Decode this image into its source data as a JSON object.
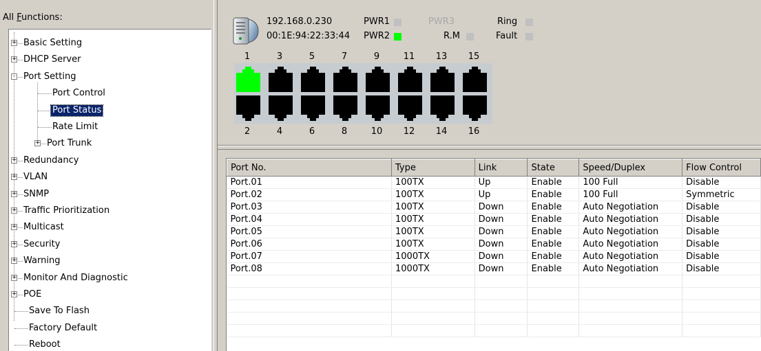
{
  "left_panel": {
    "title_prefix": "All ",
    "title_hotkey": "F",
    "title_rest": "unctions:"
  },
  "tree": [
    {
      "label": "Basic Setting",
      "expander": "+"
    },
    {
      "label": "DHCP Server",
      "expander": "+"
    },
    {
      "label": "Port Setting",
      "expander": "-"
    },
    {
      "label": "Port Control",
      "expander": ""
    },
    {
      "label": "Port Status",
      "expander": "",
      "selected": true
    },
    {
      "label": "Rate Limit",
      "expander": ""
    },
    {
      "label": "Port Trunk",
      "expander": "+"
    },
    {
      "label": "Redundancy",
      "expander": "+"
    },
    {
      "label": "VLAN",
      "expander": "+"
    },
    {
      "label": "SNMP",
      "expander": "+"
    },
    {
      "label": "Traffic Prioritization",
      "expander": "+"
    },
    {
      "label": "Multicast",
      "expander": "+"
    },
    {
      "label": "Security",
      "expander": "+"
    },
    {
      "label": "Warning",
      "expander": "+"
    },
    {
      "label": "Monitor And Diagnostic",
      "expander": "+"
    },
    {
      "label": "POE",
      "expander": "+"
    },
    {
      "label": "Save To Flash",
      "expander": ""
    },
    {
      "label": "Factory Default",
      "expander": ""
    },
    {
      "label": "Reboot",
      "expander": ""
    }
  ],
  "device": {
    "icon": "switch-device-icon",
    "ip": "192.168.0.230",
    "mac": "00:1E:94:22:33:44",
    "indicators": {
      "pwr1": {
        "label": "PWR1",
        "color": "#c0c0c0"
      },
      "pwr2": {
        "label": "PWR2",
        "color": "#00ff00"
      },
      "pwr3": {
        "label": "PWR3",
        "color": "#c0c0c0"
      },
      "rm": {
        "label": "R.M",
        "color": "#c0c0c0"
      },
      "ring": {
        "label": "Ring",
        "color": "#c0c0c0"
      },
      "fault": {
        "label": "Fault",
        "color": "#c0c0c0"
      }
    },
    "top_port_numbers": [
      "1",
      "3",
      "5",
      "7",
      "9",
      "11",
      "13",
      "15"
    ],
    "bottom_port_numbers": [
      "2",
      "4",
      "6",
      "8",
      "10",
      "12",
      "14",
      "16"
    ],
    "port_colors": {
      "active": "#00ff00",
      "inactive": "#000000"
    },
    "active_ports": [
      "1"
    ]
  },
  "table": {
    "columns": [
      "Port No.",
      "Type",
      "Link",
      "State",
      "Speed/Duplex",
      "Flow Control"
    ],
    "rows": [
      [
        "Port.01",
        "100TX",
        "Up",
        "Enable",
        "100 Full",
        "Disable"
      ],
      [
        "Port.02",
        "100TX",
        "Up",
        "Enable",
        "100 Full",
        "Symmetric"
      ],
      [
        "Port.03",
        "100TX",
        "Down",
        "Enable",
        "Auto Negotiation",
        "Disable"
      ],
      [
        "Port.04",
        "100TX",
        "Down",
        "Enable",
        "Auto Negotiation",
        "Disable"
      ],
      [
        "Port.05",
        "100TX",
        "Down",
        "Enable",
        "Auto Negotiation",
        "Disable"
      ],
      [
        "Port.06",
        "100TX",
        "Down",
        "Enable",
        "Auto Negotiation",
        "Disable"
      ],
      [
        "Port.07",
        "1000TX",
        "Down",
        "Enable",
        "Auto Negotiation",
        "Disable"
      ],
      [
        "Port.08",
        "1000TX",
        "Down",
        "Enable",
        "Auto Negotiation",
        "Disable"
      ]
    ]
  }
}
